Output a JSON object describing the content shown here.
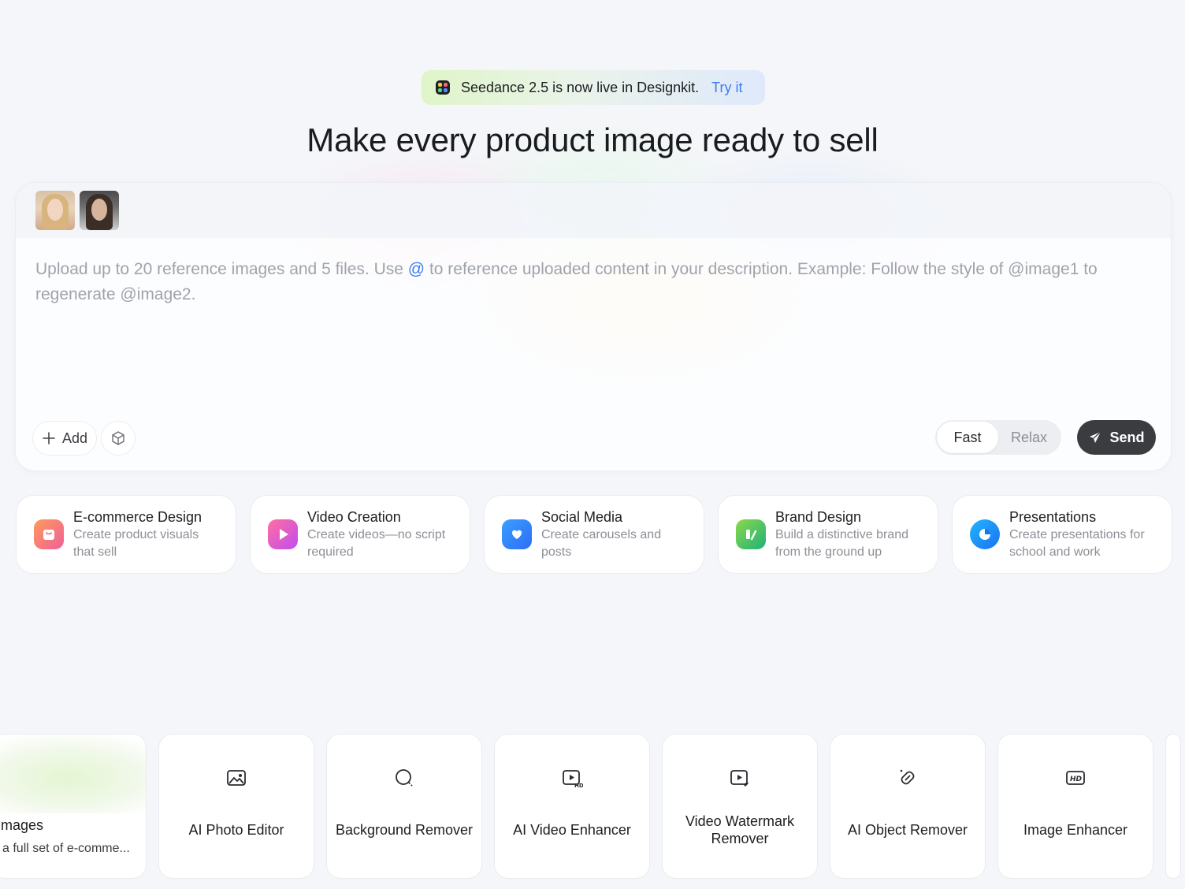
{
  "announcement": {
    "text": "Seedance 2.5 is now live in Designkit.",
    "link": "Try it"
  },
  "headline": "Make every product image ready to sell",
  "composer": {
    "placeholder_before_at": "Upload up to 20 reference images and 5 files. Use ",
    "at_symbol": "@",
    "placeholder_after_at": " to reference uploaded content in your description. Example: Follow the style of @image1 to regenerate @image2.",
    "add_label": "Add",
    "speed_options": [
      "Fast",
      "Relax"
    ],
    "speed_selected": "Fast",
    "send_label": "Send"
  },
  "categories": [
    {
      "title": "E-commerce Design",
      "desc": "Create product visuals that sell",
      "icon": "shopping-bag-icon",
      "color": "#f0609a"
    },
    {
      "title": "Video Creation",
      "desc": "Create videos—no script required",
      "icon": "play-icon",
      "color": "#e24fd6"
    },
    {
      "title": "Social Media",
      "desc": "Create carousels and posts",
      "icon": "heart-chat-icon",
      "color": "#2d8cf5"
    },
    {
      "title": "Brand Design",
      "desc": "Build a distinctive brand from the ground up",
      "icon": "brand-icon",
      "color": "#4cc15c"
    },
    {
      "title": "Presentations",
      "desc": "Create presentations for school and work",
      "icon": "pie-chart-icon",
      "color": "#1f8ef0"
    }
  ],
  "tools": [
    {
      "label": "mages",
      "sub": "a full set of e-comme..."
    },
    {
      "label": "AI Photo Editor",
      "icon": "image-edit-icon"
    },
    {
      "label": "Background Remover",
      "icon": "background-remover-icon"
    },
    {
      "label": "AI Video Enhancer",
      "icon": "video-hd-icon"
    },
    {
      "label": "Video Watermark Remover",
      "icon": "video-eraser-icon"
    },
    {
      "label": "AI Object Remover",
      "icon": "eraser-icon"
    },
    {
      "label": "Image Enhancer",
      "icon": "hd-icon"
    }
  ]
}
